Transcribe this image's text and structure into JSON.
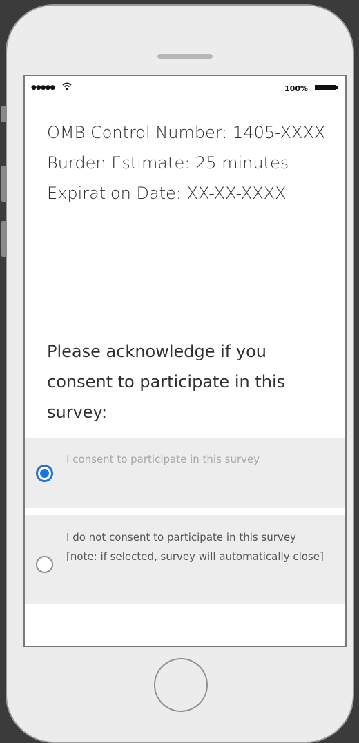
{
  "status_bar": {
    "signal_dots": "●●●●●",
    "wifi_icon": "wifi-icon",
    "battery_percent": "100%",
    "battery_icon": "battery-icon"
  },
  "info": {
    "omb_control": "OMB Control Number: 1405-XXXX",
    "burden_estimate": "Burden Estimate:  25 minutes",
    "expiration_date": "Expiration Date: XX-XX-XXXX"
  },
  "consent": {
    "prompt": "Please acknowledge if you consent to participate in this survey:",
    "options": [
      {
        "label": "I consent to participate in this survey",
        "selected": true
      },
      {
        "label": "I do not consent to participate in this survey [note: if selected, survey will automatically close]",
        "selected": false
      }
    ]
  },
  "colors": {
    "accent": "#1f74d6",
    "option_background": "#ededed"
  }
}
